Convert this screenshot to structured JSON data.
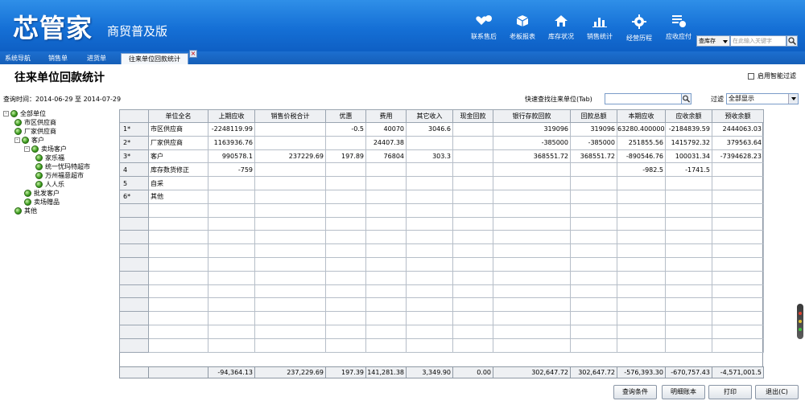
{
  "app": {
    "logo": "芯管家",
    "subtitle": "商贸普及版"
  },
  "toolbar": [
    {
      "label": "联系售后",
      "icon": "heart-chat-icon"
    },
    {
      "label": "老板报表",
      "icon": "cube-icon"
    },
    {
      "label": "库存状况",
      "icon": "house-icon"
    },
    {
      "label": "销售统计",
      "icon": "bar-chart-icon"
    },
    {
      "label": "经营历程",
      "icon": "gear-icon"
    },
    {
      "label": "应收应付",
      "icon": "list-money-icon"
    }
  ],
  "search": {
    "scope": "查库存",
    "placeholder": "在此输入关键字"
  },
  "tabs": [
    {
      "label": "系统导航"
    },
    {
      "label": "销售单"
    },
    {
      "label": "进货单"
    },
    {
      "label": "往来单位回款统计",
      "active": true
    }
  ],
  "page": {
    "title": "往来单位回款统计",
    "smart_filter_label": "启用智能过滤",
    "query_time": "查询时间：2014-06-29 至 2014-07-29",
    "quick_find_label": "快速查找往来单位(Tab)",
    "filter_label": "过滤",
    "filter_value": "全部显示"
  },
  "tree": [
    {
      "label": "全部单位",
      "level": 0,
      "toggle": "-"
    },
    {
      "label": "市区供应商",
      "level": 1,
      "toggle": ""
    },
    {
      "label": "厂家供应商",
      "level": 1,
      "toggle": ""
    },
    {
      "label": "客户",
      "level": 1,
      "toggle": "-"
    },
    {
      "label": "卖场客户",
      "level": 2,
      "toggle": "-"
    },
    {
      "label": "家乐福",
      "level": 3,
      "toggle": ""
    },
    {
      "label": "统一忧玛特超市",
      "level": 3,
      "toggle": ""
    },
    {
      "label": "万州福意超市",
      "level": 3,
      "toggle": ""
    },
    {
      "label": "人人乐",
      "level": 3,
      "toggle": ""
    },
    {
      "label": "批发客户",
      "level": 2,
      "toggle": ""
    },
    {
      "label": "卖场赠品",
      "level": 2,
      "toggle": ""
    },
    {
      "label": "其他",
      "level": 1,
      "toggle": ""
    }
  ],
  "table": {
    "columns": [
      "",
      "单位全名",
      "上期应收",
      "销售价税合计",
      "优惠",
      "费用",
      "其它收入",
      "现金回款",
      "银行存款回款",
      "回款总额",
      "本期应收",
      "应收余额",
      "预收余额"
    ],
    "rows": [
      [
        "1*",
        "市区供应商",
        "-2248119.99",
        "",
        "-0.5",
        "40070",
        "3046.6",
        "",
        "319096",
        "319096",
        "63280.400000",
        "-2184839.59",
        "2444063.03"
      ],
      [
        "2*",
        "厂家供应商",
        "1163936.76",
        "",
        "",
        "24407.38",
        "",
        "",
        "-385000",
        "-385000",
        "251855.56",
        "1415792.32",
        "379563.64"
      ],
      [
        "3*",
        "客户",
        "990578.1",
        "237229.69",
        "197.89",
        "76804",
        "303.3",
        "",
        "368551.72",
        "368551.72",
        "-890546.76",
        "100031.34",
        "-7394628.23"
      ],
      [
        "4",
        "库存数货修正",
        "-759",
        "",
        "",
        "",
        "",
        "",
        "",
        "",
        "-982.5",
        "-1741.5",
        ""
      ],
      [
        "5",
        "自采",
        "",
        "",
        "",
        "",
        "",
        "",
        "",
        "",
        "",
        "",
        ""
      ],
      [
        "6*",
        "其他",
        "",
        "",
        "",
        "",
        "",
        "",
        "",
        "",
        "",
        "",
        ""
      ]
    ],
    "totals": [
      "",
      "",
      "-94,364.13",
      "237,229.69",
      "197.39",
      "141,281.38",
      "3,349.90",
      "0.00",
      "302,647.72",
      "302,647.72",
      "-576,393.30",
      "-670,757.43",
      "-4,571,001.5"
    ]
  },
  "buttons": [
    {
      "label": "查询条件"
    },
    {
      "label": "明细账本"
    },
    {
      "label": "打印"
    },
    {
      "label": "退出(C)"
    }
  ],
  "colors": {
    "header": "#1570d6",
    "tree_node": "#3a9a1c"
  }
}
